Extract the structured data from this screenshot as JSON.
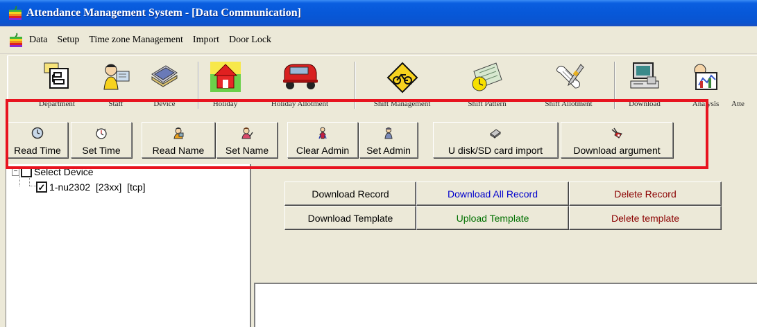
{
  "window": {
    "title": "Attendance Management System - [Data Communication]"
  },
  "menu": {
    "items": [
      "Data",
      "Setup",
      "Time zone Management",
      "Import",
      "Door Lock"
    ]
  },
  "big_toolbar": {
    "items": [
      {
        "label": "Department",
        "icon": "department-icon"
      },
      {
        "label": "Staff",
        "icon": "staff-icon"
      },
      {
        "label": "Device",
        "icon": "device-icon"
      },
      {
        "label": "Holiday",
        "icon": "holiday-icon"
      },
      {
        "label": "Holiday Allotment",
        "icon": "car-icon"
      },
      {
        "label": "Shift Management",
        "icon": "bicycle-sign-icon"
      },
      {
        "label": "Shift Pattern",
        "icon": "pattern-icon"
      },
      {
        "label": "Shift Allotment",
        "icon": "scroll-pen-icon"
      },
      {
        "label": "Download",
        "icon": "computer-icon"
      },
      {
        "label": "Analysis",
        "icon": "analysis-icon"
      },
      {
        "label": "Atte",
        "icon": ""
      }
    ]
  },
  "small_toolbar": {
    "items": [
      {
        "label": "Read Time",
        "icon": "clock-icon"
      },
      {
        "label": "Set Time",
        "icon": "alarm-clock-icon"
      },
      {
        "label": "Read Name",
        "icon": "person-icon"
      },
      {
        "label": "Set Name",
        "icon": "person-edit-icon"
      },
      {
        "label": "Clear Admin",
        "icon": "admin-clear-icon"
      },
      {
        "label": "Set Admin",
        "icon": "admin-icon"
      },
      {
        "label": "U disk/SD card import",
        "icon": "disk-icon"
      },
      {
        "label": "Download argument",
        "icon": "download-argument-icon"
      }
    ]
  },
  "tree": {
    "root_label": "Select Device",
    "root_checked": false,
    "child_label": "1-nu2302  [23xx]  [tcp]",
    "child_checked": true
  },
  "actions": {
    "download_record": "Download Record",
    "download_all_record": "Download All Record",
    "delete_record": "Delete Record",
    "download_template": "Download Template",
    "upload_template": "Upload Template",
    "delete_template": "Delete template"
  },
  "colors": {
    "highlight": "#e8131f",
    "blue_text": "#0000cc",
    "green_text": "#007000",
    "red_text": "#8b0000"
  }
}
